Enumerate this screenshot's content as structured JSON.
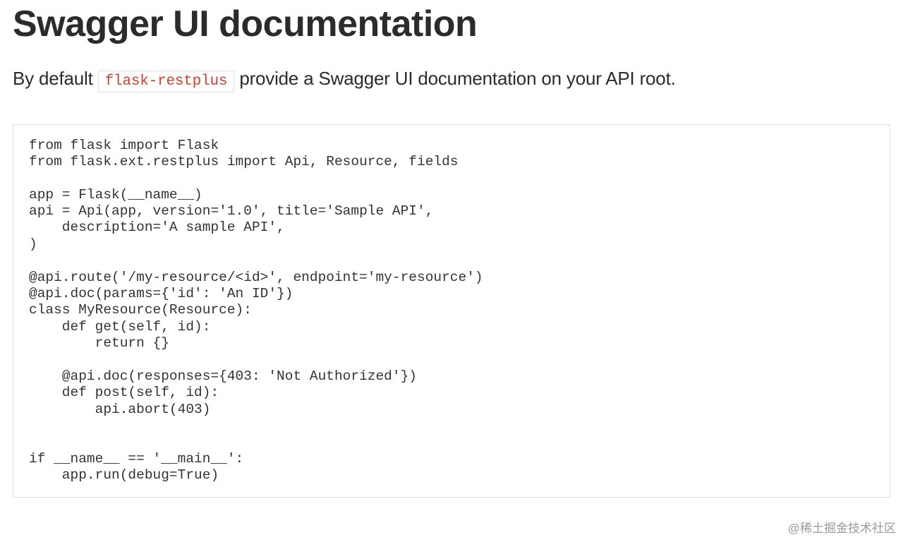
{
  "title": "Swagger UI documentation",
  "intro": {
    "before": "By default ",
    "code": "flask-restplus",
    "after": " provide a Swagger UI documentation on your API root."
  },
  "code": "from flask import Flask\nfrom flask.ext.restplus import Api, Resource, fields\n\napp = Flask(__name__)\napi = Api(app, version='1.0', title='Sample API',\n    description='A sample API',\n)\n\n@api.route('/my-resource/<id>', endpoint='my-resource')\n@api.doc(params={'id': 'An ID'})\nclass MyResource(Resource):\n    def get(self, id):\n        return {}\n\n    @api.doc(responses={403: 'Not Authorized'})\n    def post(self, id):\n        api.abort(403)\n\n\nif __name__ == '__main__':\n    app.run(debug=True)",
  "watermark": "@稀土掘金技术社区"
}
